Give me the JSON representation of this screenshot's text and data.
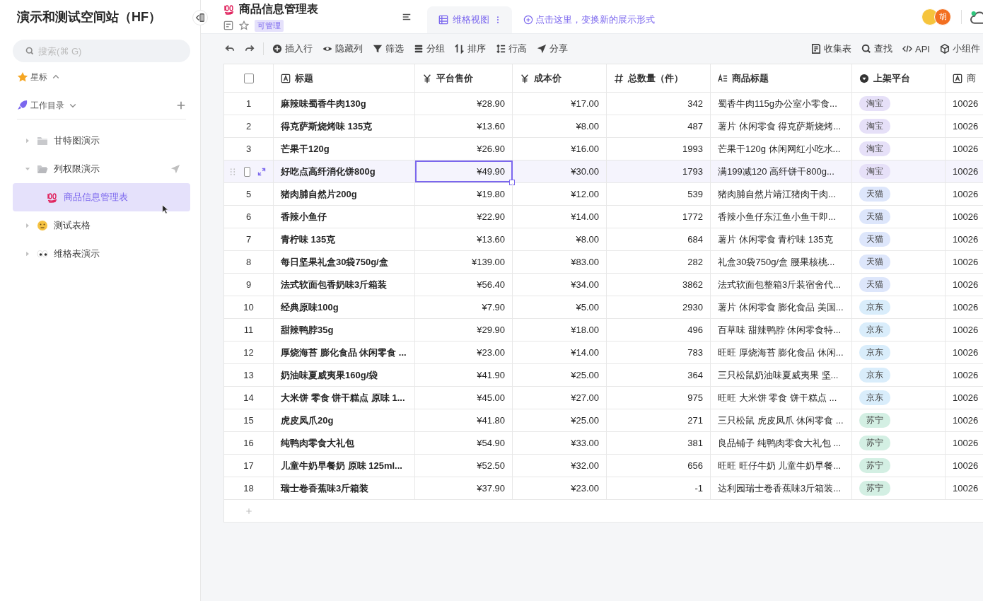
{
  "sidebar": {
    "title": "演示和测试空间站（HF）",
    "search": {
      "placeholder": "搜索(⌘ G)"
    },
    "starred": {
      "label": "星标"
    },
    "catalog": {
      "label": "工作目录",
      "items": [
        {
          "label": "甘特图演示",
          "kind": "folder",
          "expanded": false,
          "selected": false,
          "share_icon": false
        },
        {
          "label": "列权限演示",
          "kind": "folder",
          "expanded": true,
          "selected": false,
          "share_icon": true,
          "children": [
            {
              "label": "商品信息管理表",
              "kind": "sheet",
              "selected": true
            }
          ]
        },
        {
          "label": "测试表格",
          "kind": "sheet",
          "expanded": false,
          "selected": false,
          "share_icon": false
        },
        {
          "label": "维格表演示",
          "kind": "sheet",
          "expanded": false,
          "selected": false,
          "share_icon": false
        }
      ]
    }
  },
  "header": {
    "title": "商品信息管理表",
    "badge": "可管理",
    "tabs": [
      {
        "label": "维格视图",
        "selected": true
      }
    ],
    "add_view": "点击这里，变换新的展示形式",
    "avatar_initial": "胡"
  },
  "toolbar": {
    "left": [
      {
        "label": "插入行"
      },
      {
        "label": "隐藏列"
      },
      {
        "label": "筛选"
      },
      {
        "label": "分组"
      },
      {
        "label": "排序"
      },
      {
        "label": "行高"
      },
      {
        "label": "分享"
      }
    ],
    "right": [
      {
        "label": "收集表"
      },
      {
        "label": "查找"
      },
      {
        "label": "API"
      },
      {
        "label": "小组件"
      }
    ]
  },
  "table": {
    "columns": [
      {
        "label": "标题",
        "kind": "text"
      },
      {
        "label": "平台售价",
        "kind": "currency"
      },
      {
        "label": "成本价",
        "kind": "currency"
      },
      {
        "label": "总数量（件）",
        "kind": "number"
      },
      {
        "label": "商品标题",
        "kind": "longtext"
      },
      {
        "label": "上架平台",
        "kind": "select"
      },
      {
        "label": "商",
        "kind": "text"
      }
    ],
    "select_all": {
      "checked": false
    },
    "rows": [
      {
        "number": "1",
        "hovered": false,
        "price_focused": false,
        "cells": [
          "麻辣味蜀香牛肉130g",
          "¥28.90",
          "¥17.00",
          "342",
          "蜀香牛肉115g办公室小零食...",
          {
            "label": "淘宝",
            "color": "#e6e0f8"
          },
          "10026"
        ]
      },
      {
        "number": "2",
        "hovered": false,
        "price_focused": false,
        "cells": [
          "得克萨斯烧烤味 135克",
          "¥13.60",
          "¥8.00",
          "487",
          "薯片 休闲零食 得克萨斯烧烤...",
          {
            "label": "淘宝",
            "color": "#e6e0f8"
          },
          "10026"
        ]
      },
      {
        "number": "3",
        "hovered": false,
        "price_focused": false,
        "cells": [
          "芒果干120g",
          "¥26.90",
          "¥16.00",
          "1993",
          "芒果干120g 休闲网红小吃水...",
          {
            "label": "淘宝",
            "color": "#e6e0f8"
          },
          "10026"
        ]
      },
      {
        "hovered": true,
        "checked": false,
        "price_focused": true,
        "cells": [
          "好吃点高纤消化饼800g",
          "¥49.90",
          "¥30.00",
          "1793",
          "满199减120 高纤饼干800g...",
          {
            "label": "淘宝",
            "color": "#e6e0f8"
          },
          "10026"
        ]
      },
      {
        "number": "5",
        "hovered": false,
        "price_focused": false,
        "cells": [
          "猪肉脯自然片200g",
          "¥19.80",
          "¥12.00",
          "539",
          "猪肉脯自然片靖江猪肉干肉...",
          {
            "label": "天猫",
            "color": "#dde6fb"
          },
          "10026"
        ]
      },
      {
        "number": "6",
        "hovered": false,
        "price_focused": false,
        "cells": [
          "香辣小鱼仔",
          "¥22.90",
          "¥14.00",
          "1772",
          "香辣小鱼仔东江鱼小鱼干即...",
          {
            "label": "天猫",
            "color": "#dde6fb"
          },
          "10026"
        ]
      },
      {
        "number": "7",
        "hovered": false,
        "price_focused": false,
        "cells": [
          "青柠味 135克",
          "¥13.60",
          "¥8.00",
          "684",
          "薯片 休闲零食 青柠味 135克",
          {
            "label": "天猫",
            "color": "#dde6fb"
          },
          "10026"
        ]
      },
      {
        "number": "8",
        "hovered": false,
        "price_focused": false,
        "cells": [
          "每日坚果礼盒30袋750g/盒",
          "¥139.00",
          "¥83.00",
          "282",
          "礼盒30袋750g/盒 腰果核桃...",
          {
            "label": "天猫",
            "color": "#dde6fb"
          },
          "10026"
        ]
      },
      {
        "number": "9",
        "hovered": false,
        "price_focused": false,
        "cells": [
          "法式软面包香奶味3斤箱装",
          "¥56.40",
          "¥34.00",
          "3862",
          "法式软面包整箱3斤装宿舍代...",
          {
            "label": "天猫",
            "color": "#dde6fb"
          },
          "10026"
        ]
      },
      {
        "number": "10",
        "hovered": false,
        "price_focused": false,
        "cells": [
          "经典原味100g",
          "¥7.90",
          "¥5.00",
          "2930",
          "薯片 休闲零食 膨化食品 美国...",
          {
            "label": "京东",
            "color": "#d9edfb"
          },
          "10026"
        ]
      },
      {
        "number": "11",
        "hovered": false,
        "price_focused": false,
        "cells": [
          "甜辣鸭脖35g",
          "¥29.90",
          "¥18.00",
          "496",
          "百草味 甜辣鸭脖 休闲零食特...",
          {
            "label": "京东",
            "color": "#d9edfb"
          },
          "10026"
        ]
      },
      {
        "number": "12",
        "hovered": false,
        "price_focused": false,
        "cells": [
          "厚烧海苔 膨化食品 休闲零食 ...",
          "¥23.00",
          "¥14.00",
          "783",
          "旺旺 厚烧海苔 膨化食品 休闲...",
          {
            "label": "京东",
            "color": "#d9edfb"
          },
          "10026"
        ]
      },
      {
        "number": "13",
        "hovered": false,
        "price_focused": false,
        "cells": [
          "奶油味夏威夷果160g/袋",
          "¥41.90",
          "¥25.00",
          "364",
          "三只松鼠奶油味夏威夷果 坚...",
          {
            "label": "京东",
            "color": "#d9edfb"
          },
          "10026"
        ]
      },
      {
        "number": "14",
        "hovered": false,
        "price_focused": false,
        "cells": [
          "大米饼 零食 饼干糕点 原味 1...",
          "¥45.00",
          "¥27.00",
          "975",
          "旺旺 大米饼 零食 饼干糕点 ...",
          {
            "label": "京东",
            "color": "#d9edfb"
          },
          "10026"
        ]
      },
      {
        "number": "15",
        "hovered": false,
        "price_focused": false,
        "cells": [
          "虎皮凤爪20g",
          "¥41.80",
          "¥25.00",
          "271",
          "三只松鼠 虎皮凤爪 休闲零食 ...",
          {
            "label": "苏宁",
            "color": "#d3efe3"
          },
          "10026"
        ]
      },
      {
        "number": "16",
        "hovered": false,
        "price_focused": false,
        "cells": [
          "纯鸭肉零食大礼包",
          "¥54.90",
          "¥33.00",
          "381",
          "良品铺子 纯鸭肉零食大礼包 ...",
          {
            "label": "苏宁",
            "color": "#d3efe3"
          },
          "10026"
        ]
      },
      {
        "number": "17",
        "hovered": false,
        "price_focused": false,
        "cells": [
          "儿童牛奶早餐奶 原味 125ml...",
          "¥52.50",
          "¥32.00",
          "656",
          "旺旺 旺仔牛奶 儿童牛奶早餐...",
          {
            "label": "苏宁",
            "color": "#d3efe3"
          },
          "10026"
        ]
      },
      {
        "number": "18",
        "hovered": false,
        "price_focused": false,
        "cells": [
          "瑞士卷香蕉味3斤箱装",
          "¥37.90",
          "¥23.00",
          "-1",
          "达利园瑞士卷香蕉味3斤箱装...",
          {
            "label": "苏宁",
            "color": "#d3efe3"
          },
          "10026"
        ]
      }
    ]
  }
}
